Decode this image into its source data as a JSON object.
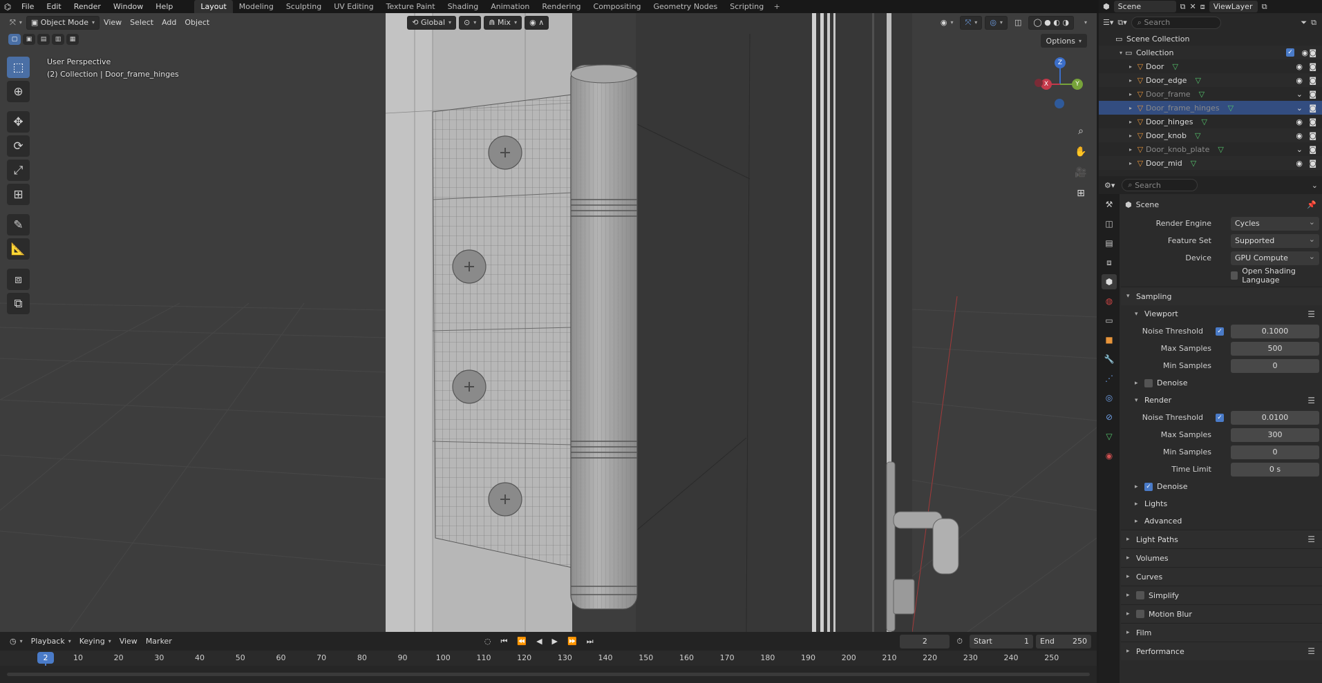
{
  "topbar": {
    "menus": [
      "File",
      "Edit",
      "Render",
      "Window",
      "Help"
    ],
    "workspaces": [
      "Layout",
      "Modeling",
      "Sculpting",
      "UV Editing",
      "Texture Paint",
      "Shading",
      "Animation",
      "Rendering",
      "Compositing",
      "Geometry Nodes",
      "Scripting"
    ],
    "active_workspace": "Layout"
  },
  "viewport": {
    "mode": "Object Mode",
    "menus": [
      "View",
      "Select",
      "Add",
      "Object"
    ],
    "orientation": "Global",
    "snap_mode": "Mix",
    "options_label": "Options",
    "info_line1": "User Perspective",
    "info_line2": "(2) Collection | Door_frame_hinges",
    "gizmo": {
      "z": "Z",
      "y": "Y",
      "x": "X"
    }
  },
  "timeline": {
    "menus": [
      "Playback",
      "Keying",
      "View",
      "Marker"
    ],
    "current_frame": "2",
    "start_label": "Start",
    "start": "1",
    "end_label": "End",
    "end": "250",
    "ticks": [
      "10",
      "20",
      "30",
      "40",
      "50",
      "60",
      "70",
      "80",
      "90",
      "100",
      "110",
      "120",
      "130",
      "140",
      "150",
      "160",
      "170",
      "180",
      "190",
      "200",
      "210",
      "220",
      "230",
      "240",
      "250"
    ]
  },
  "outliner_top": {
    "scene": "Scene",
    "view_layer": "ViewLayer"
  },
  "outliner": {
    "search_placeholder": "Search",
    "scene_collection": "Scene Collection",
    "collection": "Collection",
    "objects": [
      {
        "name": "Door",
        "dim": false,
        "selected": false
      },
      {
        "name": "Door_edge",
        "dim": false,
        "selected": false
      },
      {
        "name": "Door_frame",
        "dim": true,
        "selected": false
      },
      {
        "name": "Door_frame_hinges",
        "dim": true,
        "selected": true
      },
      {
        "name": "Door_hinges",
        "dim": false,
        "selected": false
      },
      {
        "name": "Door_knob",
        "dim": false,
        "selected": false
      },
      {
        "name": "Door_knob_plate",
        "dim": true,
        "selected": false
      },
      {
        "name": "Door_mid",
        "dim": false,
        "selected": false
      }
    ]
  },
  "properties": {
    "search_placeholder": "Search",
    "context": "Scene",
    "render_engine_label": "Render Engine",
    "render_engine": "Cycles",
    "feature_set_label": "Feature Set",
    "feature_set": "Supported",
    "device_label": "Device",
    "device": "GPU Compute",
    "osl_label": "Open Shading Language",
    "sampling": "Sampling",
    "viewport_sub": "Viewport",
    "noise_threshold_label": "Noise Threshold",
    "vp_noise_threshold": "0.1000",
    "max_samples_label": "Max Samples",
    "vp_max_samples": "500",
    "min_samples_label": "Min Samples",
    "vp_min_samples": "0",
    "denoise_label": "Denoise",
    "render_sub": "Render",
    "r_noise_threshold": "0.0100",
    "r_max_samples": "300",
    "r_min_samples": "0",
    "time_limit_label": "Time Limit",
    "r_time_limit": "0 s",
    "lights": "Lights",
    "advanced": "Advanced",
    "light_paths": "Light Paths",
    "volumes": "Volumes",
    "curves": "Curves",
    "simplify": "Simplify",
    "motion_blur": "Motion Blur",
    "film": "Film",
    "performance": "Performance"
  },
  "colors": {
    "accent": "#4a7bc8",
    "selection": "#334d80",
    "object_icon": "#e8953a",
    "mesh_icon": "#55c46c"
  }
}
